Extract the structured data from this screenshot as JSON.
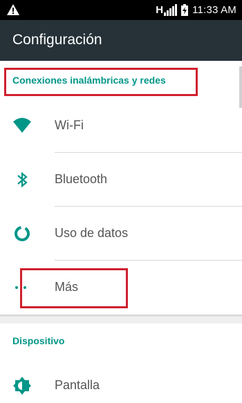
{
  "status_bar": {
    "network_type": "H",
    "time": "11:33 AM",
    "warning_icon": "warning-icon",
    "battery_icon": "battery-charging-icon"
  },
  "app_bar": {
    "title": "Configuración"
  },
  "sections": [
    {
      "title": "Conexiones inalámbricas y redes",
      "items": [
        {
          "label": "Wi-Fi",
          "icon": "wifi-icon"
        },
        {
          "label": "Bluetooth",
          "icon": "bluetooth-icon"
        },
        {
          "label": "Uso de datos",
          "icon": "data-usage-icon"
        },
        {
          "label": "Más",
          "icon": "more-icon"
        }
      ]
    },
    {
      "title": "Dispositivo",
      "items": [
        {
          "label": "Pantalla",
          "icon": "brightness-icon"
        }
      ]
    }
  ],
  "colors": {
    "accent": "#009688",
    "app_bar": "#263238",
    "status_bar": "#000000",
    "highlight": "#d0202e"
  }
}
